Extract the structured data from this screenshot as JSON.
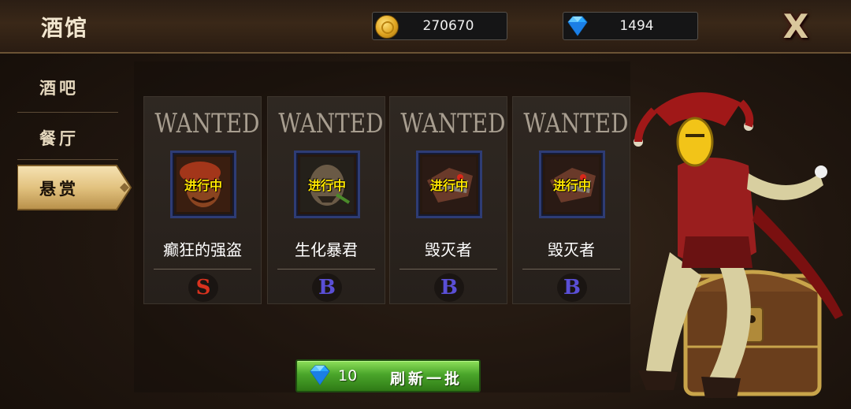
{
  "header": {
    "title": "酒馆",
    "gold": "270670",
    "gems": "1494",
    "close_label": "X"
  },
  "sidebar": {
    "items": [
      {
        "label": "酒吧",
        "active": false
      },
      {
        "label": "餐厅",
        "active": false
      },
      {
        "label": "悬赏",
        "active": true
      }
    ]
  },
  "cards": [
    {
      "header": "WANTED",
      "status": "进行中",
      "name": "癫狂的强盗",
      "grade": "S",
      "grade_color": "#d8321e"
    },
    {
      "header": "WANTED",
      "status": "进行中",
      "name": "生化暴君",
      "grade": "B",
      "grade_color": "#5a4fd6"
    },
    {
      "header": "WANTED",
      "status": "进行中",
      "name": "毁灭者",
      "grade": "B",
      "grade_color": "#5a4fd6"
    },
    {
      "header": "WANTED",
      "status": "进行中",
      "name": "毁灭者",
      "grade": "B",
      "grade_color": "#5a4fd6"
    }
  ],
  "refresh": {
    "cost": "10",
    "label": "刷新一批"
  },
  "colors": {
    "accent_gold": "#e6c37a",
    "button_green": "#4aa52a",
    "status_yellow": "#ffe600"
  }
}
